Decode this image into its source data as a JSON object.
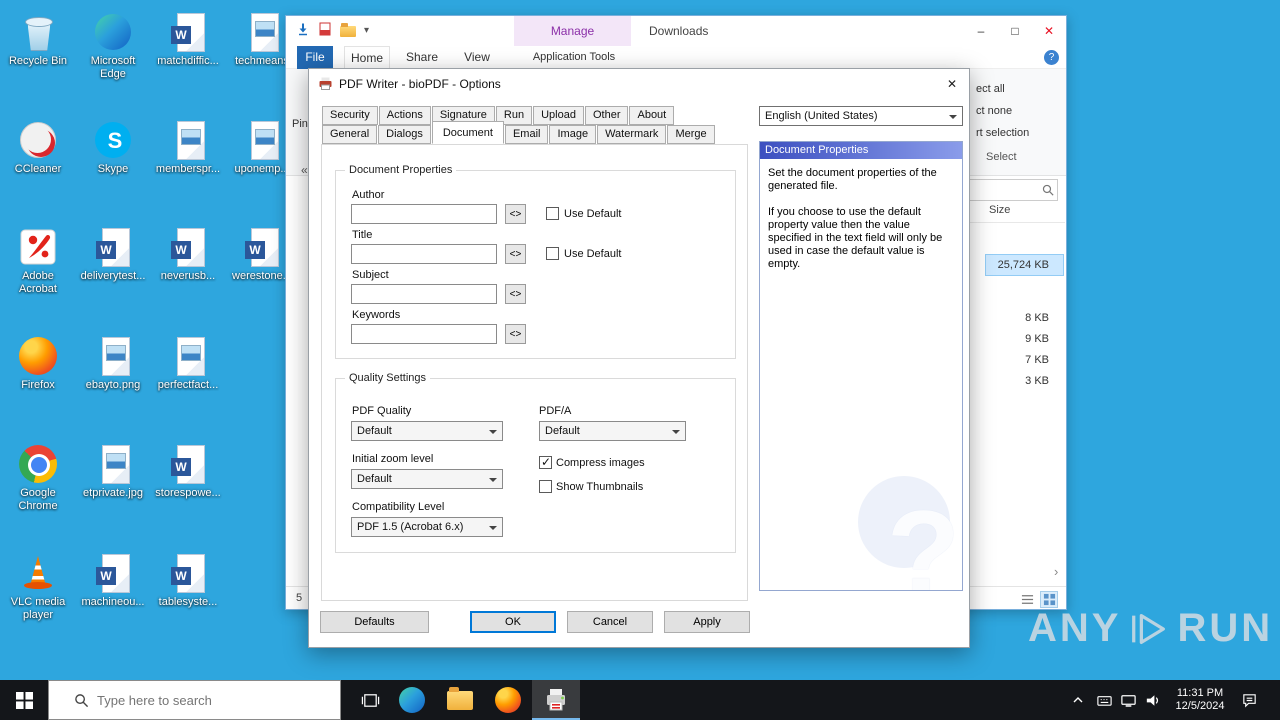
{
  "colors": {
    "accent": "#0078D7",
    "desktop_background": "#2EA6DE",
    "selection": "#CCE8FF",
    "manage_tab": "#8B2FA8",
    "close_x": "#E81123",
    "side_header_gradient": [
      "#3C4FC0",
      "#8A9CEA"
    ]
  },
  "desktop": {
    "icons": [
      {
        "label": "Recycle Bin",
        "kind": "recycle-bin-icon"
      },
      {
        "label": "CCleaner",
        "kind": "ccleaner-icon"
      },
      {
        "label": "Adobe Acrobat",
        "kind": "acrobat-icon"
      },
      {
        "label": "Firefox",
        "kind": "firefox-icon"
      },
      {
        "label": "Google Chrome",
        "kind": "chrome-icon"
      },
      {
        "label": "VLC media player",
        "kind": "vlc-icon"
      },
      {
        "label": "Microsoft Edge",
        "kind": "edge-icon"
      },
      {
        "label": "Skype",
        "kind": "skype-icon"
      },
      {
        "label": "deliverytest...",
        "kind": "word-document-icon"
      },
      {
        "label": "ebayto.png",
        "kind": "image-file-icon"
      },
      {
        "label": "etprivate.jpg",
        "kind": "image-file-icon"
      },
      {
        "label": "machineou...",
        "kind": "word-document-icon"
      },
      {
        "label": "matchdiffic...",
        "kind": "word-document-icon"
      },
      {
        "label": "memberspr...",
        "kind": "image-file-icon"
      },
      {
        "label": "neverusb...",
        "kind": "word-document-icon"
      },
      {
        "label": "perfectfact...",
        "kind": "image-file-icon"
      },
      {
        "label": "storespowe...",
        "kind": "word-document-icon"
      },
      {
        "label": "tablesyste...",
        "kind": "word-document-icon"
      },
      {
        "label": "techmeans",
        "kind": "image-file-icon"
      },
      {
        "label": "uponemp...",
        "kind": "image-file-icon"
      },
      {
        "label": "werestone...",
        "kind": "word-document-icon"
      }
    ]
  },
  "explorer": {
    "title": "Downloads",
    "manage_label": "Manage",
    "tabs": [
      "File",
      "Home",
      "Share",
      "View"
    ],
    "tool_tab": "Application Tools",
    "help_label": "?",
    "window_controls": {
      "minimize": "–",
      "maximize": "□",
      "close": "✕"
    },
    "select_group": {
      "items": [
        "ect all",
        "ct none",
        "rt selection"
      ],
      "label": "Select"
    },
    "pin_text": "Pin",
    "nav_collapse": "«",
    "size_header": "Size",
    "files": [
      {
        "size": "25,724 KB",
        "selected": true
      },
      {
        "size": "8 KB",
        "selected": false
      },
      {
        "size": "9 KB",
        "selected": false
      },
      {
        "size": "7 KB",
        "selected": false
      },
      {
        "size": "3 KB",
        "selected": false
      }
    ],
    "status_count": "5",
    "scroll_arrow": "›"
  },
  "dialog": {
    "title": "PDF Writer - bioPDF - Options",
    "close": "✕",
    "tabs_row1": [
      "Security",
      "Actions",
      "Signature",
      "Run",
      "Upload",
      "Other",
      "About"
    ],
    "tabs_row2": [
      "General",
      "Dialogs",
      "Document",
      "Email",
      "Image",
      "Watermark",
      "Merge"
    ],
    "selected_tab": "Document",
    "language_value": "English (United States)",
    "side_panel": {
      "header": "Document Properties",
      "para1": "Set the document properties of the generated file.",
      "para2": "If you choose to use the default property value then the value specified in the text field will only be used in case the default value is empty.",
      "watermark": "?"
    },
    "doc_group": {
      "legend": "Document Properties",
      "fields": [
        {
          "label": "Author",
          "value": "",
          "macro": "<>",
          "use_default": "Use Default",
          "checked": false
        },
        {
          "label": "Title",
          "value": "",
          "macro": "<>",
          "use_default": "Use Default",
          "checked": false
        },
        {
          "label": "Subject",
          "value": "",
          "macro": "<>"
        },
        {
          "label": "Keywords",
          "value": "",
          "macro": "<>"
        }
      ]
    },
    "quality_group": {
      "legend": "Quality Settings",
      "pdf_quality": {
        "label": "PDF Quality",
        "value": "Default"
      },
      "pdfa": {
        "label": "PDF/A",
        "value": "Default"
      },
      "zoom": {
        "label": "Initial zoom level",
        "value": "Default"
      },
      "compress": {
        "label": "Compress images",
        "checked": true
      },
      "thumbnails": {
        "label": "Show Thumbnails",
        "checked": false
      },
      "compat": {
        "label": "Compatibility Level",
        "value": "PDF 1.5 (Acrobat 6.x)"
      }
    },
    "buttons": {
      "defaults": "Defaults",
      "ok": "OK",
      "cancel": "Cancel",
      "apply": "Apply"
    }
  },
  "taskbar": {
    "search_placeholder": "Type here to search",
    "clock": {
      "time": "11:31 PM",
      "date": "12/5/2024"
    }
  },
  "watermark": {
    "any": "ANY",
    "run": "RUN"
  }
}
